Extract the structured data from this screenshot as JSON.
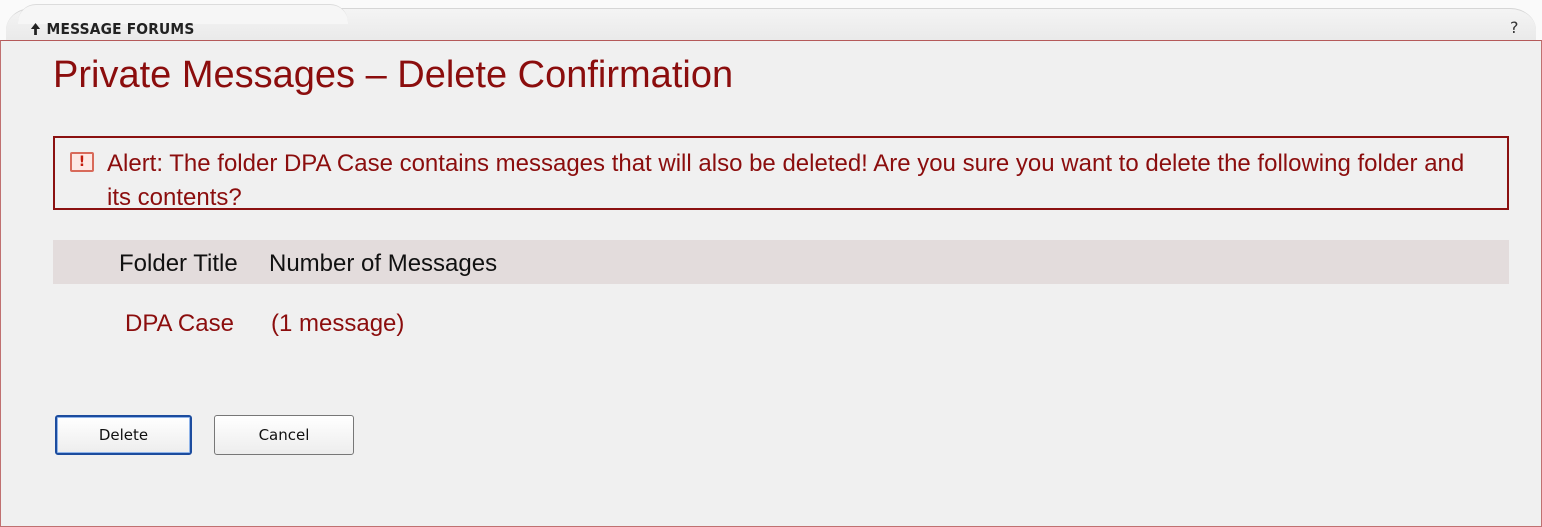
{
  "header": {
    "tool_title": "MESSAGE FORUMS",
    "help_label": "?"
  },
  "page": {
    "title": "Private Messages – Delete Confirmation"
  },
  "alert": {
    "text": "Alert: The folder DPA Case contains messages that will also be deleted!  Are you sure you want to delete the following folder and its contents?",
    "icon": "alert-exclamation-icon"
  },
  "table": {
    "columns": [
      "Folder Title",
      "Number of Messages"
    ],
    "rows": [
      {
        "folder": "DPA Case",
        "count": "(1 message)"
      }
    ]
  },
  "buttons": {
    "delete_label": "Delete",
    "cancel_label": "Cancel"
  },
  "colors": {
    "accent": "#8b0d0d",
    "panel_bg": "#f0f0f0",
    "header_row_bg": "#e3dcdc",
    "default_button_border": "#1c4c9e"
  }
}
